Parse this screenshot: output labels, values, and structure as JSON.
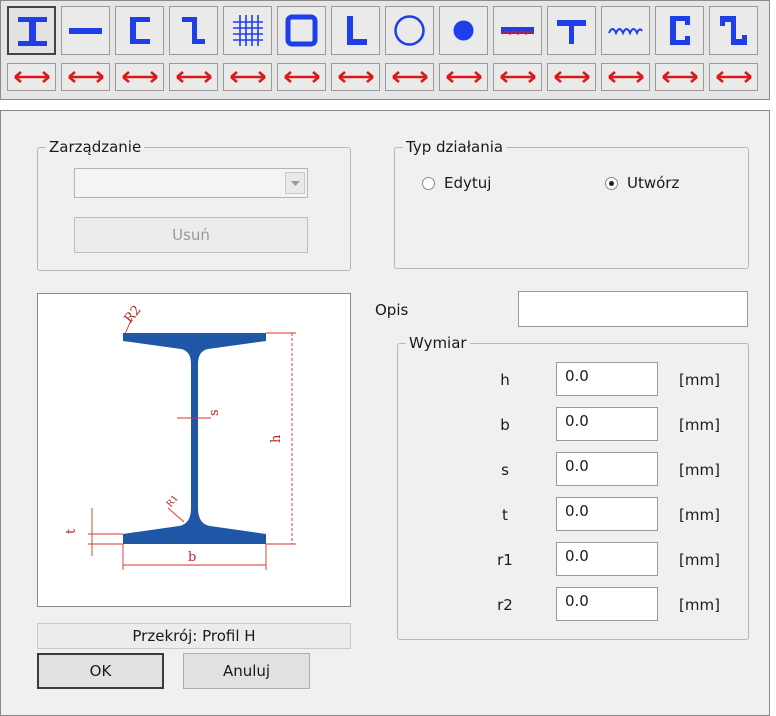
{
  "toolbar": {
    "buttons": [
      {
        "icon": "i-beam-icon"
      },
      {
        "icon": "flat-bar-icon"
      },
      {
        "icon": "c-channel-icon"
      },
      {
        "icon": "z-section-icon"
      },
      {
        "icon": "grating-icon"
      },
      {
        "icon": "rectangular-tube-icon"
      },
      {
        "icon": "angle-section-icon"
      },
      {
        "icon": "round-tube-icon"
      },
      {
        "icon": "round-bar-icon"
      },
      {
        "icon": "plate-icon"
      },
      {
        "icon": "t-section-icon"
      },
      {
        "icon": "corrugated-sheet-icon"
      },
      {
        "icon": "lipped-channel-icon"
      },
      {
        "icon": "lipped-z-section-icon"
      }
    ],
    "width_icon": "width-arrow-icon",
    "colors": {
      "icon_blue": "#1e3eea",
      "arrow_red": "#d81a1a"
    }
  },
  "management": {
    "title": "Zarządzanie",
    "combo_value": "",
    "delete_label": "Usuń"
  },
  "action_type": {
    "title": "Typ działania",
    "edit_label": "Edytuj",
    "create_label": "Utwórz",
    "selected": "create"
  },
  "description": {
    "label": "Opis",
    "value": ""
  },
  "dimensions": {
    "title": "Wymiar",
    "rows": [
      {
        "name": "h",
        "value": "0.0",
        "unit": "[mm]"
      },
      {
        "name": "b",
        "value": "0.0",
        "unit": "[mm]"
      },
      {
        "name": "s",
        "value": "0.0",
        "unit": "[mm]"
      },
      {
        "name": "t",
        "value": "0.0",
        "unit": "[mm]"
      },
      {
        "name": "r1",
        "value": "0.0",
        "unit": "[mm]"
      },
      {
        "name": "r2",
        "value": "0.0",
        "unit": "[mm]"
      }
    ]
  },
  "preview": {
    "labels": {
      "r2": "R2",
      "s": "s",
      "h": "h",
      "r1": "R1",
      "t": "t",
      "b": "b"
    },
    "colors": {
      "section": "#1f57a6",
      "dimension": "#d9302e"
    }
  },
  "caption": "Przekrój: Profil H",
  "buttons": {
    "ok": "OK",
    "cancel": "Anuluj"
  }
}
